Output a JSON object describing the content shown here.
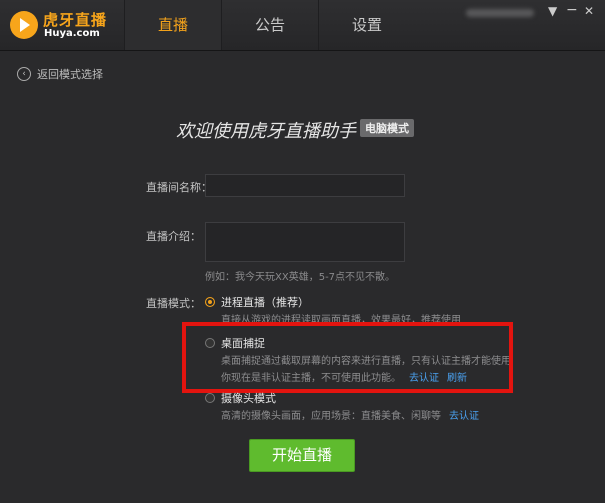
{
  "app": {
    "logo_cn": "虎牙直播",
    "logo_en": "Huya.com"
  },
  "nav": {
    "tabs": [
      {
        "label": "直播",
        "active": true
      },
      {
        "label": "公告",
        "active": false
      },
      {
        "label": "设置",
        "active": false
      }
    ]
  },
  "window_controls": {
    "dropdown": "▼",
    "minimize": "−",
    "close": "✕"
  },
  "back": {
    "icon": "‹",
    "label": "返回模式选择"
  },
  "heading": {
    "title": "欢迎使用虎牙直播助手",
    "badge": "电脑模式"
  },
  "form": {
    "room_name_label": "直播间名称：",
    "room_name_value": "",
    "intro_label": "直播介绍：",
    "intro_value": "",
    "intro_hint": "例如：我今天玩XX英雄，5-7点不见不散。",
    "mode_label": "直播模式："
  },
  "modes": [
    {
      "title": "进程直播（推荐）",
      "desc": "直接从游戏的进程读取画面直播，效果最好，推荐使用",
      "checked": true
    },
    {
      "title": "桌面捕捉",
      "desc_line1": "桌面捕捉通过截取屏幕的内容来进行直播，只有认证主播才能使用",
      "desc_line2": "你现在是非认证主播，不可使用此功能。",
      "link_verify": "去认证",
      "link_refresh": "刷新",
      "checked": false
    },
    {
      "title": "摄像头模式",
      "desc": "高清的摄像头画面，应用场景：直播美食、闲聊等",
      "link_verify": "去认证",
      "checked": false
    }
  ],
  "actions": {
    "start_label": "开始直播"
  },
  "colors": {
    "accent": "#f3a21b",
    "start_button": "#5fbb2e",
    "link": "#4aa1f0",
    "highlight": "#e3140f"
  }
}
